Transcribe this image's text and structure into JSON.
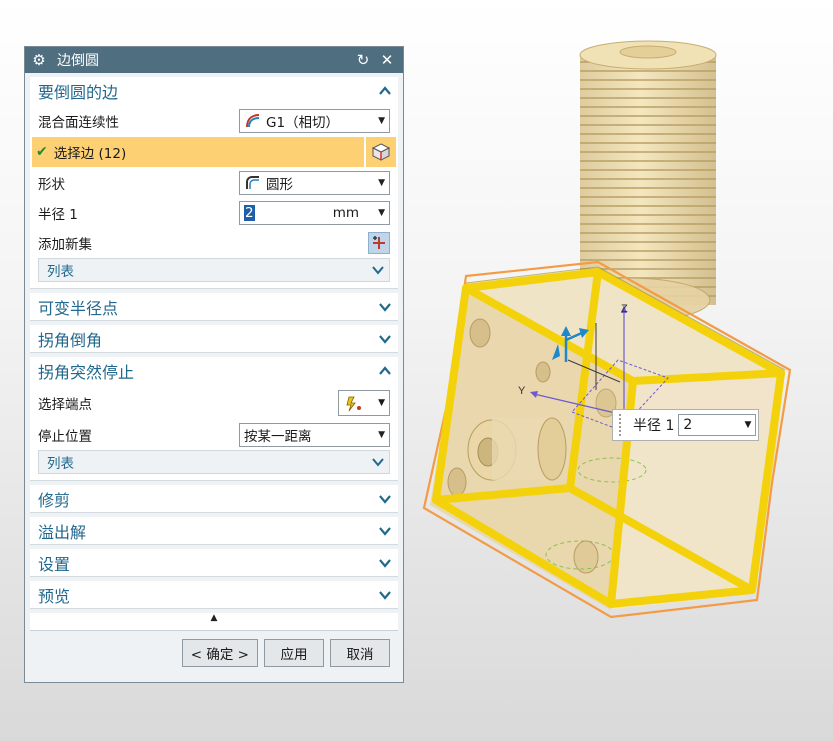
{
  "dialog": {
    "title": "边倒圆",
    "sections": {
      "edges": {
        "title": "要倒圆的边",
        "continuity_label": "混合面连续性",
        "continuity_value": "G1（相切）",
        "select_edge": "选择边 (12)",
        "shape_label": "形状",
        "shape_value": "圆形",
        "radius_label": "半径 1",
        "radius_value": "2",
        "radius_unit": "mm",
        "add_set_label": "添加新集",
        "list_label": "列表"
      },
      "variable_radius": {
        "title": "可变半径点"
      },
      "corner_setback": {
        "title": "拐角倒角"
      },
      "corner_stop": {
        "title": "拐角突然停止",
        "select_endpoint_label": "选择端点",
        "stop_position_label": "停止位置",
        "stop_position_value": "按某一距离",
        "list_label": "列表"
      },
      "trim": {
        "title": "修剪"
      },
      "overflow": {
        "title": "溢出解"
      },
      "settings": {
        "title": "设置"
      },
      "preview": {
        "title": "预览"
      }
    },
    "buttons": {
      "ok": "< 确定 >",
      "apply": "应用",
      "cancel": "取消"
    }
  },
  "float_radius": {
    "label": "半径 1",
    "value": "2"
  },
  "axes": {
    "z": "Z",
    "y": "Y"
  },
  "colors": {
    "title_bar": "#4f6f80",
    "section_title": "#22688e",
    "highlight": "#fdd074",
    "edge_selected": "#f3d20c",
    "part_body": "#e8d4a8",
    "bbox": "#f39b45"
  }
}
